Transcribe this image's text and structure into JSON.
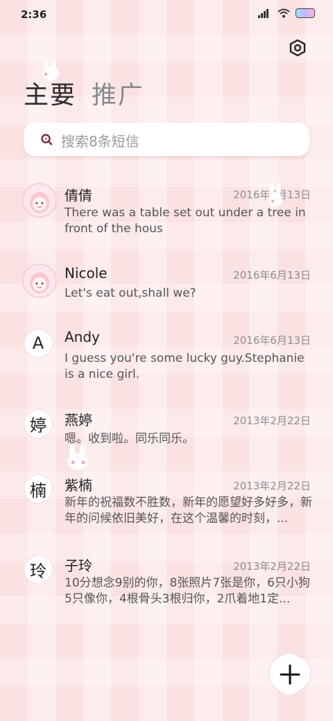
{
  "status": {
    "time": "2:36"
  },
  "tabs": [
    {
      "label": "主要"
    },
    {
      "label": "推广"
    }
  ],
  "search": {
    "placeholder": "搜索8条短信"
  },
  "conversations": [
    {
      "name": "倩倩",
      "date": "2016年6月13日",
      "preview": "There was a table set out under a tree in front of the hous",
      "avatar": "photo"
    },
    {
      "name": "Nicole",
      "date": "2016年6月13日",
      "preview": "Let's eat out,shall we?",
      "avatar": "photo"
    },
    {
      "name": "Andy",
      "date": "2016年6月13日",
      "preview": "I guess you're some lucky guy.Stephanie is a nice girl.",
      "avatar_letter": "A"
    },
    {
      "name": "燕婷",
      "date": "2013年2月22日",
      "preview": "嗯。收到啦。同乐同乐。",
      "avatar_letter": "婷"
    },
    {
      "name": "紫楠",
      "date": "2013年2月22日",
      "preview": "新年的祝福数不胜数，新年的愿望好多好多，新年的问候依旧美好，在这个温馨的时刻，...",
      "avatar_letter": "楠"
    },
    {
      "name": "子玲",
      "date": "2013年2月22日",
      "preview": "10分想念9别的你，8张照片7张是你，6只小狗5只像你，4根骨头3根归你，2爪着地1定...",
      "avatar_letter": "玲"
    }
  ],
  "icons": {
    "settings": "settings-icon",
    "search": "search-icon",
    "compose": "plus-icon"
  },
  "colors": {
    "accent": "#7a2e3a",
    "background": "#fbe2e2"
  }
}
